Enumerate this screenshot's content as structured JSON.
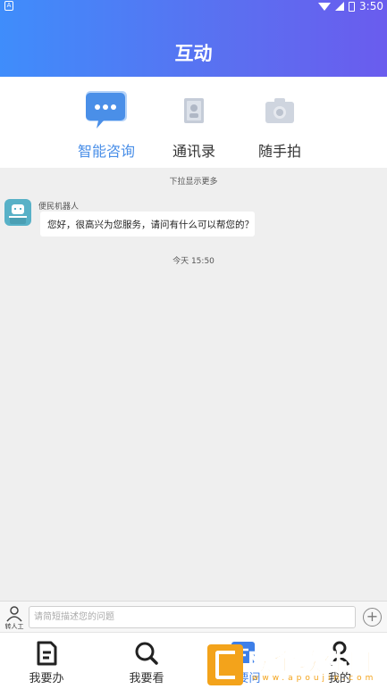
{
  "status_bar": {
    "time": "3:50"
  },
  "header": {
    "title": "互动"
  },
  "tabs": [
    {
      "label": "智能咨询",
      "icon": "chat-bubble-icon",
      "active": true,
      "color": "#4a8fe8"
    },
    {
      "label": "通讯录",
      "icon": "contact-book-icon",
      "active": false
    },
    {
      "label": "随手拍",
      "icon": "camera-icon",
      "active": false
    }
  ],
  "chat": {
    "pull_hint": "下拉显示更多",
    "bot_name": "便民机器人",
    "bot_message": "您好，很高兴为您服务，请问有什么可以帮您的？",
    "time_label": "今天 15:50"
  },
  "input_bar": {
    "agent_label": "转人工",
    "placeholder": "请简短描述您的问题",
    "add_label": "+"
  },
  "bottom_nav": [
    {
      "label": "我要办",
      "icon": "document-icon"
    },
    {
      "label": "我要看",
      "icon": "search-icon"
    },
    {
      "label": "我要问",
      "icon": "chat-icon",
      "active": true
    },
    {
      "label": "我的",
      "icon": "person-icon"
    }
  ],
  "watermark": {
    "text": "欧金软件园",
    "sub": "www.apoujin.com"
  },
  "colors": {
    "accent": "#4a8fe8",
    "header_start": "#3f8dfb",
    "header_end": "#6a5cee"
  }
}
